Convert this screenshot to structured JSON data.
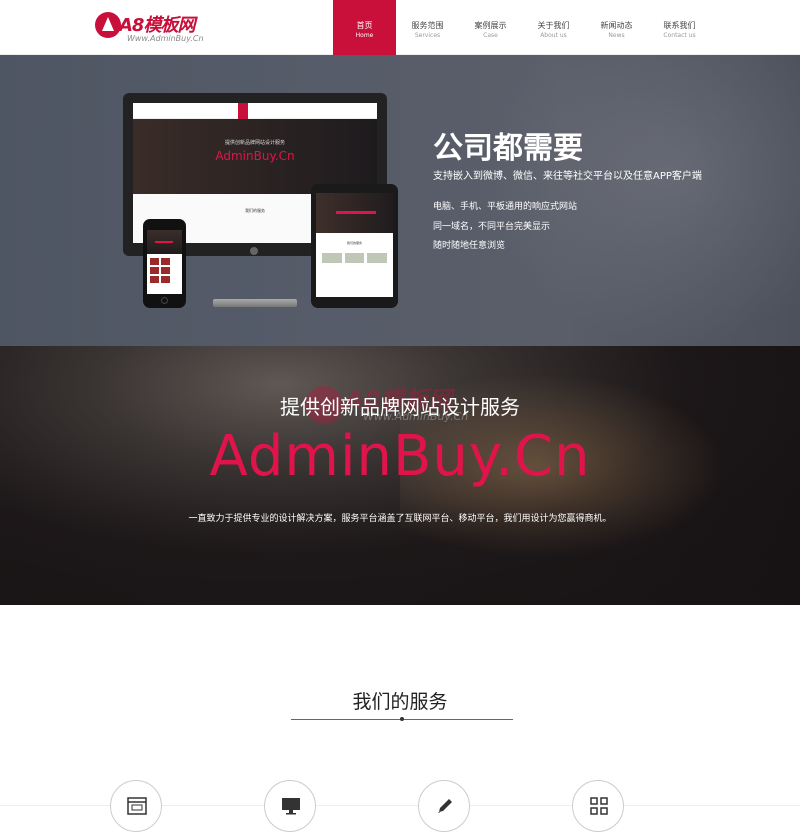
{
  "brand": {
    "logo_text": "A8模板网",
    "logo_sub": "Www.AdminBuy.Cn"
  },
  "nav": [
    {
      "cn": "首页",
      "en": "Home",
      "active": true
    },
    {
      "cn": "服务范围",
      "en": "Services"
    },
    {
      "cn": "案例展示",
      "en": "Case"
    },
    {
      "cn": "关于我们",
      "en": "About us"
    },
    {
      "cn": "新闻动态",
      "en": "News"
    },
    {
      "cn": "联系我们",
      "en": "Contact us"
    }
  ],
  "hero1": {
    "title": "公司都需要",
    "subtitle": "支持嵌入到微博、微信、来往等社交平台以及任意APP客户端",
    "features": [
      "电脑、手机、平板通用的响应式网站",
      "同一域名，不同平台完美显示",
      "随时随地任意浏览"
    ],
    "mock_screen": {
      "title": "提供创新品牌网站设计服务",
      "brand": "AdminBuy.Cn",
      "section": "我们的服务"
    }
  },
  "hero2": {
    "title": "提供创新品牌网站设计服务",
    "brand": "AdminBuy.Cn",
    "description": "一直致力于提供专业的设计解决方案，服务平台涵盖了互联网平台、移动平台，我们用设计为您赢得商机。",
    "watermark_text": "A8模板网",
    "watermark_sub": "Www.AdminBuy.Cn"
  },
  "services": {
    "title": "我们的服务",
    "icons": [
      "web-design-icon",
      "monitor-icon",
      "pencil-icon",
      "grid-icon"
    ]
  },
  "colors": {
    "accent": "#c8103a",
    "brand_text": "#e0144a"
  }
}
